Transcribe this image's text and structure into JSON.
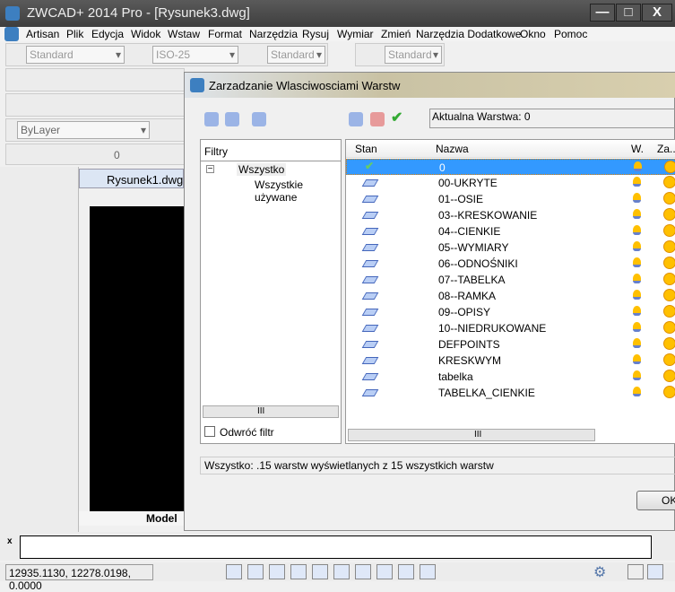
{
  "app": {
    "title": "ZWCAD+ 2014 Pro - [Rysunek3.dwg]",
    "window_buttons": [
      "—",
      "□",
      "X"
    ]
  },
  "menu": [
    "Artisan",
    "Plik",
    "Edycja",
    "Widok",
    "Wstaw",
    "Format",
    "Narzędzia",
    "Rysuj",
    "Wymiar",
    "Zmień",
    "Narzędzia Dodatkowe",
    "Okno",
    "Pomoc"
  ],
  "toolbar": {
    "text_style": "Standard",
    "dim_style": "ISO-25",
    "table_style": "Standard",
    "multileader_style": "Standard",
    "layer_combo": "ByLayer",
    "layer_current": "0"
  },
  "drawing": {
    "tab": "Rysunek1.dwg",
    "layout_tab": "Model"
  },
  "dialog": {
    "title": "Zarzadzanie Wlasciwosciami Warstw",
    "current_layer": "Aktualna Warstwa: 0",
    "filters_header": "Filtry",
    "tree": [
      {
        "label": "Wszystko"
      },
      {
        "label": "Wszystkie używane"
      }
    ],
    "invert_filter": "Odwróć filtr",
    "columns": {
      "state": "Stan",
      "name": "Nazwa",
      "on": "W.",
      "freeze": "Za.."
    },
    "layers": [
      "0",
      "00-UKRYTE",
      "01--OSIE",
      "03--KRESKOWANIE",
      "04--CIENKIE",
      "05--WYMIARY",
      "06--ODNOŚNIKI",
      "07--TABELKA",
      "08--RAMKA",
      "09--OPISY",
      "10--NIEDRUKOWANE",
      "DEFPOINTS",
      "KRESKWYM",
      "tabelka",
      "TABELKA_CIENKIE"
    ],
    "summary": "Wszystko: .15 warstw wyświetlanych z  15 wszystkich warstw",
    "ok": "OK",
    "hscroll": "III"
  },
  "statusbar": {
    "coords": "12935.1130, 12278.0198, 0.0000"
  },
  "colors": {
    "selection": "#3399ff",
    "titlebar": "#4a4a4a"
  }
}
